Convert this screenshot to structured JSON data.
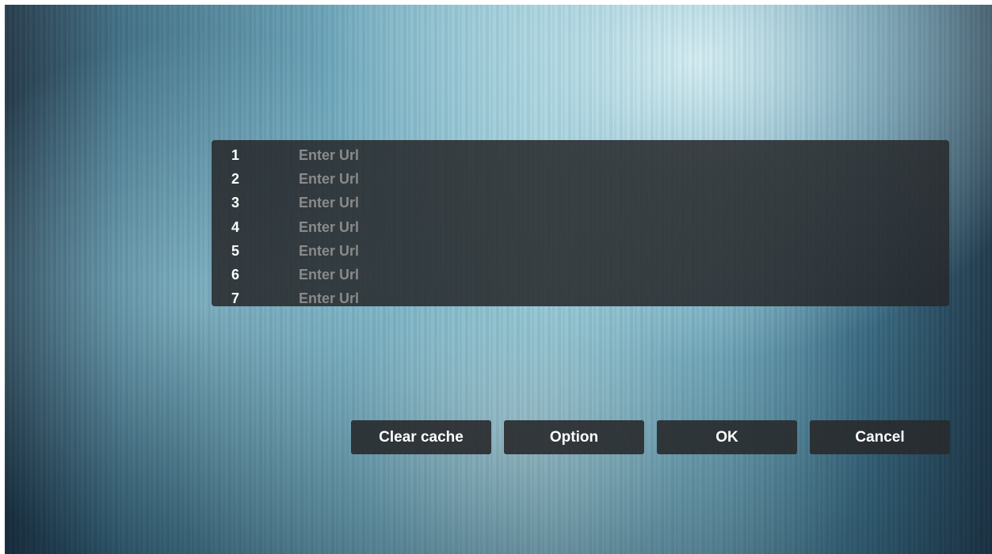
{
  "url_list": {
    "rows": [
      {
        "number": "1",
        "placeholder": "Enter Url"
      },
      {
        "number": "2",
        "placeholder": "Enter Url"
      },
      {
        "number": "3",
        "placeholder": "Enter Url"
      },
      {
        "number": "4",
        "placeholder": "Enter Url"
      },
      {
        "number": "5",
        "placeholder": "Enter Url"
      },
      {
        "number": "6",
        "placeholder": "Enter Url"
      },
      {
        "number": "7",
        "placeholder": "Enter Url"
      }
    ]
  },
  "buttons": {
    "clear_cache": "Clear cache",
    "option": "Option",
    "ok": "OK",
    "cancel": "Cancel"
  },
  "colors": {
    "panel": "#26282a",
    "button": "#282a2c",
    "text": "#ffffff",
    "placeholder": "#8a8a8a"
  }
}
